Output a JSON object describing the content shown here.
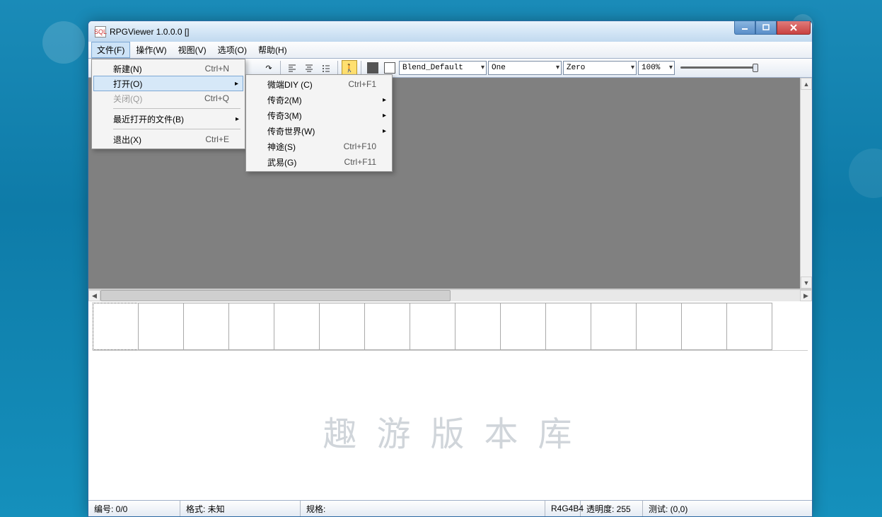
{
  "title": "RPGViewer 1.0.0.0 []",
  "menubar": [
    "文件(F)",
    "操作(W)",
    "视图(V)",
    "选项(O)",
    "帮助(H)"
  ],
  "toolbar": {
    "blend": "Blend_Default",
    "src": "One",
    "dst": "Zero",
    "zoom": "100%"
  },
  "file_menu": {
    "new": {
      "label": "新建(N)",
      "shortcut": "Ctrl+N"
    },
    "open": {
      "label": "打开(O)",
      "shortcut": ""
    },
    "close": {
      "label": "关闭(Q)",
      "shortcut": "Ctrl+Q"
    },
    "recent": {
      "label": "最近打开的文件(B)",
      "shortcut": ""
    },
    "exit": {
      "label": "退出(X)",
      "shortcut": "Ctrl+E"
    }
  },
  "open_submenu": {
    "i0": {
      "label": "微端DIY (C)",
      "shortcut": "Ctrl+F1"
    },
    "i1": {
      "label": "传奇2(M)",
      "shortcut": ""
    },
    "i2": {
      "label": "传奇3(M)",
      "shortcut": ""
    },
    "i3": {
      "label": "传奇世界(W)",
      "shortcut": ""
    },
    "i4": {
      "label": "神途(S)",
      "shortcut": "Ctrl+F10"
    },
    "i5": {
      "label": "武易(G)",
      "shortcut": "Ctrl+F11"
    }
  },
  "status": {
    "index": "编号: 0/0",
    "format": "格式: 未知",
    "spec": "规格:",
    "pixfmt": "R4G4B4",
    "alpha": "透明度:  255",
    "test": "测试:  (0,0)"
  },
  "watermark": "趣 游 版 本 库"
}
